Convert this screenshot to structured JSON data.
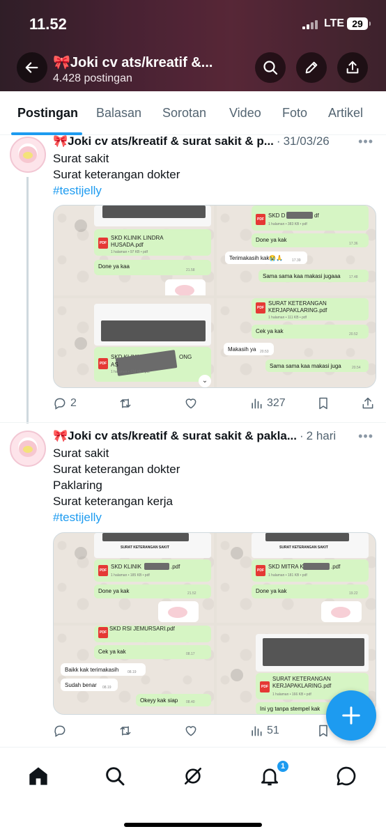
{
  "status_bar": {
    "time": "11.52",
    "network": "LTE",
    "battery": "29"
  },
  "header": {
    "title": "🎀Joki cv ats/kreatif &...",
    "post_count": "4.428 postingan",
    "back_icon": "arrow-left-icon",
    "search_icon": "search-icon",
    "edit_icon": "pencil-icon",
    "share_icon": "share-icon"
  },
  "tabs": [
    "Postingan",
    "Balasan",
    "Sorotan",
    "Video",
    "Foto",
    "Artikel"
  ],
  "active_tab": "Postingan",
  "posts": [
    {
      "name": "🎀Joki cv ats/kreatif & surat sakit & p...",
      "date": "31/03/26",
      "lines": [
        "Surat sakit",
        "Surat keterangan dokter"
      ],
      "hashtag": "#testijelly",
      "media": {
        "tl": {
          "file": "SKD KLINIK LINDRA HUSADA.pdf",
          "sub": "1 halaman • 97 KB • pdf",
          "msg": "Done ya kaa",
          "time": "21.58"
        },
        "tr": {
          "file": "SKD D",
          "file_end": "df",
          "sub": "1 halaman • 383 KB • pdf",
          "msg": "Done ya kak",
          "time": "17.36",
          "msg2": "Terimakasih kak😭🙏",
          "time2": "17.39",
          "msg3": "Sama sama kaa makasi jugaaa",
          "time3": "17.48"
        },
        "bl": {
          "file": "SKD KLINIK",
          "file_end": "ONG",
          "file_line2": "AS",
          "sub": "1 halaman • 128 KB • pdf"
        },
        "br": {
          "file": "SURAT KETERANGAN KERJAPAKLARING.pdf",
          "sub": "1 halaman • 111 KB • pdf",
          "msg": "Cek ya kak",
          "time": "20.52",
          "msg2": "Makasih ya",
          "time2": "20.53",
          "msg3": "Sama sama kaa makasi juga",
          "time3": "20.54"
        }
      },
      "replies": "2",
      "views": "327"
    },
    {
      "name": "🎀Joki cv ats/kreatif & surat sakit & pakla...",
      "date": "2 hari",
      "lines": [
        "Surat sakit",
        "Surat keterangan dokter",
        "Paklaring",
        "Surat keterangan kerja"
      ],
      "hashtag": "#testijelly",
      "media": {
        "tl": {
          "file": "SKD KLINIK",
          "file_end": ".pdf",
          "sub": "1 halaman • 185 KB • pdf",
          "msg": "Done ya kak",
          "time": "21.52",
          "doc_title": "SURAT KETERANGAN SAKIT"
        },
        "tr": {
          "file": "SKD MITRA K",
          "file_end": ".pdf",
          "sub": "1 halaman • 181 KB • pdf",
          "msg": "Done ya kak",
          "time": "19.22",
          "doc_title": "SURAT KETERANGAN SAKIT"
        },
        "bl": {
          "file": "SKD RSI JEMURSARI.pdf",
          "msg": "Cek ya kak",
          "time": "08.17",
          "msg2": "Baikk kak terimakasih",
          "time2": "08.19",
          "msg3": "Sudah benar",
          "time3": "08.19",
          "msg4": "Okeyy kak siap",
          "time4": "08.40"
        },
        "br": {
          "file": "SURAT KETERANGAN KERJAPAKLARING.pdf",
          "sub": "1 halaman • 166 KB • pdf",
          "msg": "Ini yg tanpa stempel kak"
        }
      },
      "views": "51"
    }
  ],
  "bottom_nav": [
    "home-icon",
    "search-icon",
    "grok-icon",
    "notifications-icon",
    "messages-icon"
  ],
  "notification_badge": "1",
  "colors": {
    "accent": "#1d9bf0",
    "text": "#0f1419",
    "muted": "#536471"
  }
}
